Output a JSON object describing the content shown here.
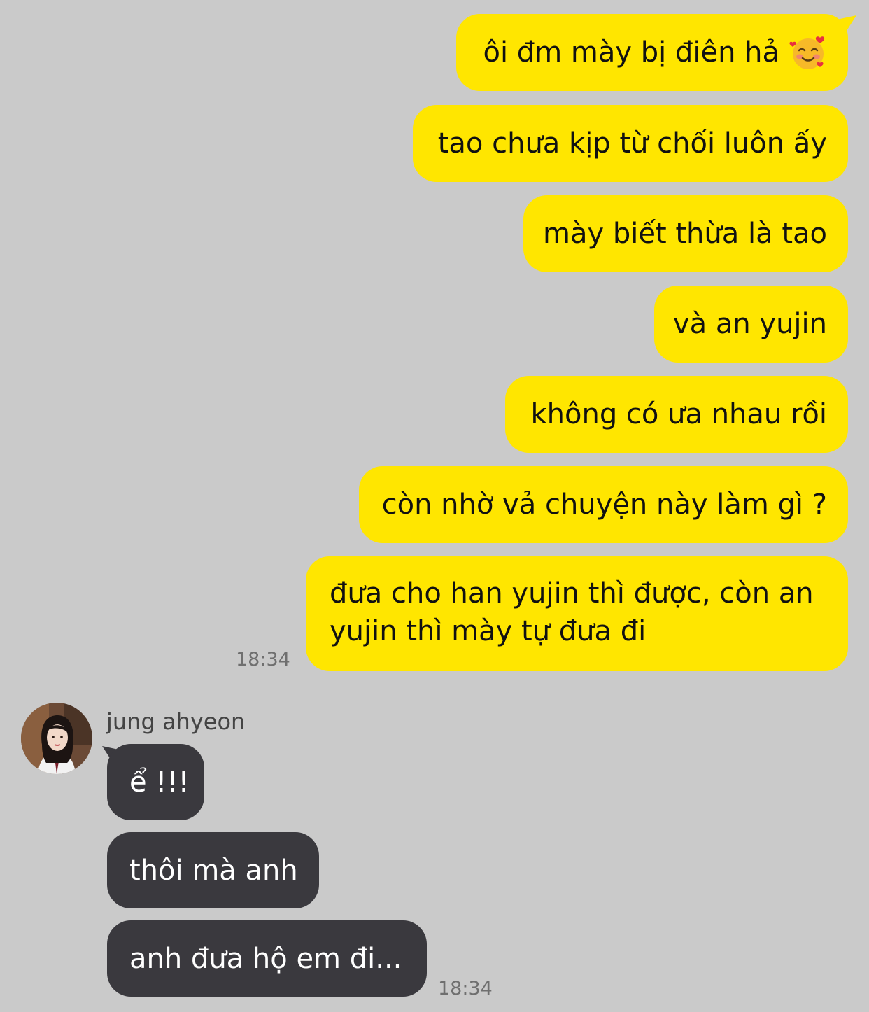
{
  "colors": {
    "background": "#cacaca",
    "outgoing_bubble": "#ffe600",
    "incoming_bubble": "#3a393e",
    "timestamp": "#6f6f6f"
  },
  "outgoing": {
    "messages": [
      {
        "text": "ôi đm mày bị điên hả",
        "emoji": "smiling-face-with-hearts-icon"
      },
      {
        "text": "tao chưa kịp từ chối luôn ấy"
      },
      {
        "text": "mày biết thừa là tao"
      },
      {
        "text": "và an yujin"
      },
      {
        "text": "không có ưa nhau rồi"
      },
      {
        "text": "còn nhờ vả chuyện này làm gì ?"
      },
      {
        "text": "đưa cho han yujin thì được, còn an yujin thì mày tự đưa đi"
      }
    ],
    "time": "18:34"
  },
  "incoming": {
    "sender": "jung ahyeon",
    "avatar": "profile-photo-icon",
    "messages": [
      {
        "text": "ể !!!"
      },
      {
        "text": "thôi mà anh"
      },
      {
        "text": "anh đưa hộ em đi..."
      }
    ],
    "time": "18:34"
  }
}
